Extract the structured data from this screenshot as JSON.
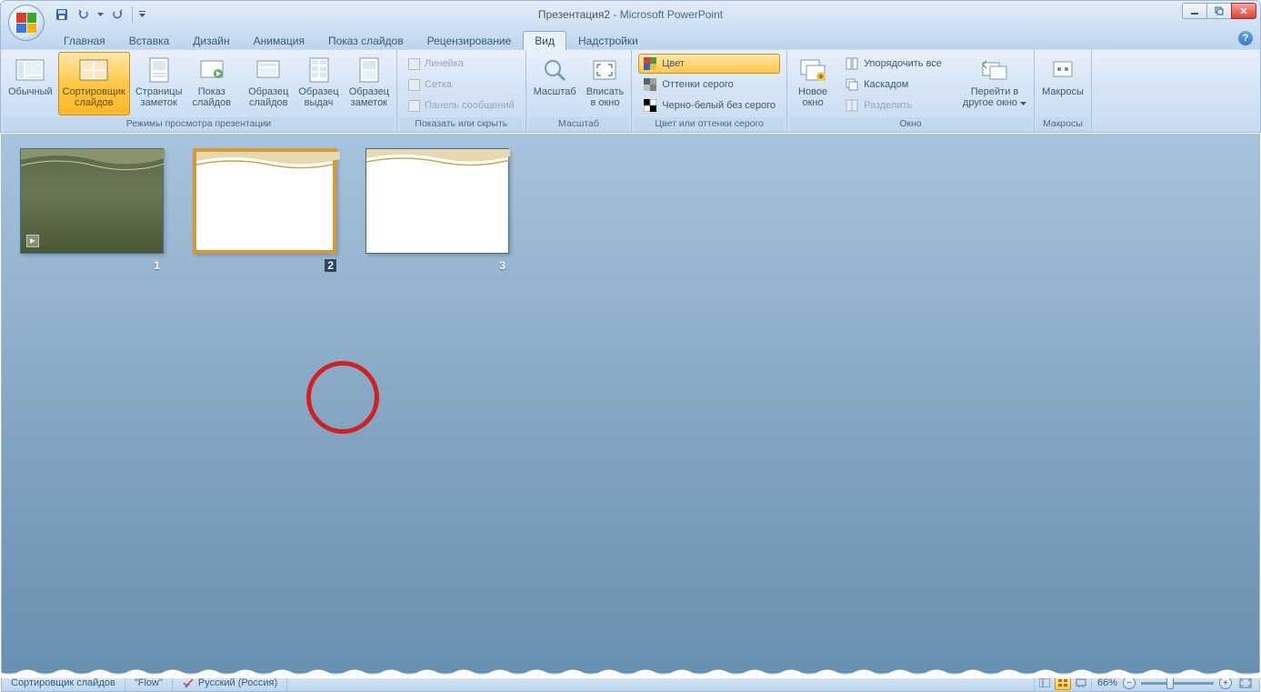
{
  "title": {
    "doc": "Презентация2",
    "app": "Microsoft PowerPoint"
  },
  "tabs": {
    "home": "Главная",
    "insert": "Вставка",
    "design": "Дизайн",
    "animations": "Анимация",
    "slideshow": "Показ слайдов",
    "review": "Рецензирование",
    "view": "Вид",
    "addins": "Надстройки"
  },
  "ribbon": {
    "views": {
      "label": "Режимы просмотра презентации",
      "normal": "Обычный",
      "sorter_l1": "Сортировщик",
      "sorter_l2": "слайдов",
      "notes_l1": "Страницы",
      "notes_l2": "заметок",
      "show_l1": "Показ",
      "show_l2": "слайдов",
      "master_slide_l1": "Образец",
      "master_slide_l2": "слайдов",
      "master_handout_l1": "Образец",
      "master_handout_l2": "выдач",
      "master_notes_l1": "Образец",
      "master_notes_l2": "заметок"
    },
    "showhide": {
      "label": "Показать или скрыть",
      "ruler": "Линейка",
      "grid": "Сетка",
      "msgbar": "Панель сообщений"
    },
    "zoom": {
      "label": "Масштаб",
      "zoom": "Масштаб",
      "fit_l1": "Вписать",
      "fit_l2": "в окно"
    },
    "color": {
      "label": "Цвет или оттенки серого",
      "color": "Цвет",
      "gray": "Оттенки серого",
      "bw": "Черно-белый без серого"
    },
    "window": {
      "label": "Окно",
      "new_l1": "Новое",
      "new_l2": "окно",
      "arrange": "Упорядочить все",
      "cascade": "Каскадом",
      "split": "Разделить",
      "switch_l1": "Перейти в",
      "switch_l2": "другое окно"
    },
    "macros": {
      "label": "Макросы",
      "macros": "Макросы"
    }
  },
  "slides": {
    "n1": "1",
    "n2": "2",
    "n3": "3"
  },
  "status": {
    "mode": "Сортировщик слайдов",
    "theme": "\"Flow\"",
    "lang": "Русский (Россия)",
    "zoom": "66%"
  }
}
